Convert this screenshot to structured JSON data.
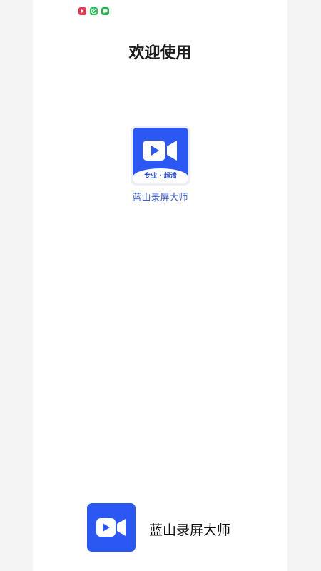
{
  "page": {
    "title": "欢迎使用"
  },
  "status_bar": {
    "icons": [
      {
        "name": "video-app-icon",
        "color": "#e8344f"
      },
      {
        "name": "upload-app-icon",
        "color": "#2bc35a"
      },
      {
        "name": "message-app-icon",
        "color": "#25b24a"
      }
    ]
  },
  "app": {
    "name": "蓝山录屏大师",
    "tag": "专业 · 超清",
    "icon": "video-camera-icon"
  },
  "footer": {
    "name": "蓝山录屏大师"
  },
  "colors": {
    "brand": "#2b57f2",
    "brand_text": "#3a5fd6",
    "tag_text": "#1f44c8"
  }
}
